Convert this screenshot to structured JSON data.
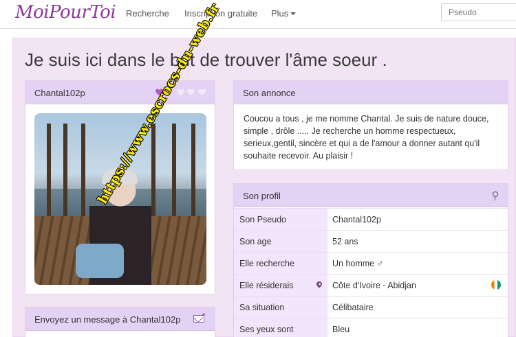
{
  "nav": {
    "logo": "MoiPourToi",
    "links": [
      "Recherche",
      "Inscription gratuite",
      "Plus"
    ],
    "search_placeholder": "Pseudo"
  },
  "page_title": "Je suis ici dans le but de trouver l'âme soeur .",
  "left": {
    "username": "Chantal102p",
    "watermark": "https://www.escrocs-du-web.fr",
    "message_label": "Envoyez un message à Chantal102p"
  },
  "annonce": {
    "title": "Son annonce",
    "text": "Coucou a tous , je me nomme Chantal. Je suis de nature douce, simple , drôle ..... Je recherche un homme respectueux, serieux,gentil, sincère et qui a de l'amour a donner autant qu'il souhaite recevoir. Au plaisir !"
  },
  "profil": {
    "title": "Son profil",
    "rows": [
      {
        "label": "Son Pseudo",
        "value": "Chantal102p"
      },
      {
        "label": "Son age",
        "value": "52 ans"
      },
      {
        "label": "Elle recherche",
        "value": "Un homme ♂"
      },
      {
        "label": "Elle résiderais",
        "value": "Côte d'Ivoire - Abidjan"
      },
      {
        "label": "Sa situation",
        "value": "Célibataire"
      },
      {
        "label": "Ses yeux sont",
        "value": "Bleu"
      }
    ]
  },
  "colors": {
    "brand": "#8b3b96",
    "panel_header": "#e4d2f5",
    "background": "#f3e4f5"
  }
}
